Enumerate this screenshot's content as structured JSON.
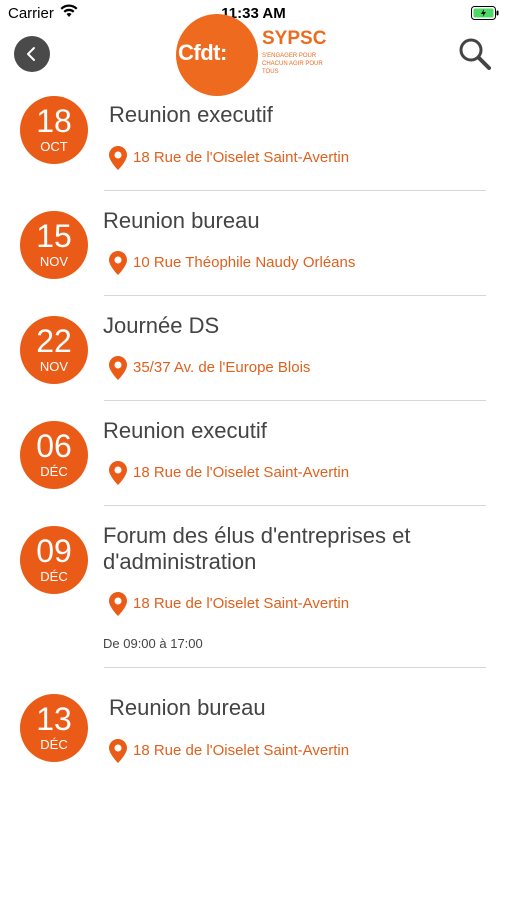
{
  "status": {
    "carrier": "Carrier",
    "time": "11:33 AM"
  },
  "header": {
    "logo_text": "Cfdt:",
    "org": "SYPSC",
    "tagline": "S'ENGAGER POUR CHACUN AGIR POUR TOUS"
  },
  "events": [
    {
      "day": "18",
      "month": "OCT",
      "title": "Reunion executif",
      "location": "18 Rue de l'Oiselet Saint-Avertin"
    },
    {
      "day": "15",
      "month": "NOV",
      "title": "Reunion bureau",
      "location": "10 Rue Théophile Naudy Orléans"
    },
    {
      "day": "22",
      "month": "NOV",
      "title": "Journée DS",
      "location": "35/37 Av. de l'Europe Blois"
    },
    {
      "day": "06",
      "month": "DÉC",
      "title": "Reunion executif",
      "location": "18 Rue de l'Oiselet Saint-Avertin"
    },
    {
      "day": "09",
      "month": "DÉC",
      "title_line1": "Forum des élus d'entreprises et",
      "title_line2": "d'administration",
      "location": "18 Rue de l'Oiselet Saint-Avertin",
      "time": "De 09:00 à 17:00"
    },
    {
      "day": "13",
      "month": "DÉC",
      "title": "Reunion bureau",
      "location": "18 Rue de l'Oiselet Saint-Avertin"
    }
  ],
  "colors": {
    "accent": "#ea5b17",
    "logo": "#ee6a1f",
    "location_text": "#e0601e"
  }
}
